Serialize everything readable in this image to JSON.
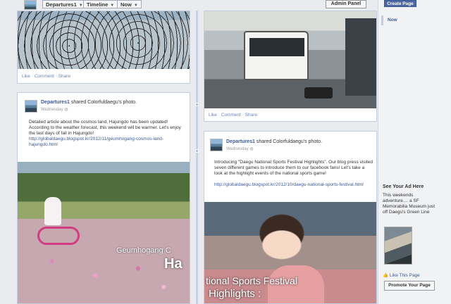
{
  "topbar": {
    "page_name": "Departures1",
    "timeline_label": "Timeline",
    "now_label": "Now",
    "admin_label": "Admin Panel"
  },
  "rail": {
    "create_page_label": "Create Page",
    "now_label": "Now",
    "ad_title": "See Your Ad Here",
    "ad_text": "This weekends adventure.... a SF Memorabilia Museum just off Daegu's Green Line",
    "like_page_label": "Like This Page",
    "promote_label": "Promote Your Page"
  },
  "posts": {
    "bikes": {
      "footer_like": "Like",
      "footer_comment": "Comment",
      "footer_share": "Share"
    },
    "bus": {
      "footer_like": "Like",
      "footer_comment": "Comment",
      "footer_share": "Share"
    },
    "cosmos": {
      "author": "Departures1",
      "action": "shared Colorfuldaegu's photo.",
      "date": "Wednesday",
      "text": "Detailed article about the cosmos land, Hajungdo has been updated! According to the weather forecast, this weekend will be warmer. Let's enjoy the last days of fall in Hajungdo!",
      "link": "http://globaldaegu.blogspot.kr/2012/11/geumhogang-cosmos-land-hajungdo.html",
      "caption1": "Geumhogang C",
      "caption2": "Ha"
    },
    "sports": {
      "author": "Departures1",
      "action": "shared Colorfuldaegu's photo.",
      "date": "Wednesday",
      "text": "Introducing \"Daegu National Sports Festival Highlights\". Our blog press visited seven different games to introduce them to our facebook fans! Let's take a look at the highlight events of the national sports game!",
      "link": "http://globaldaegu.blogspot.kr/2012/10/daegu-national-sports-festival.html",
      "caption1": "tional Sports Festival",
      "caption2": "Highlights :"
    }
  },
  "colors": {
    "brand_blue": "#3b5998",
    "card_border": "#c4cde0",
    "background": "#e9ebee"
  }
}
